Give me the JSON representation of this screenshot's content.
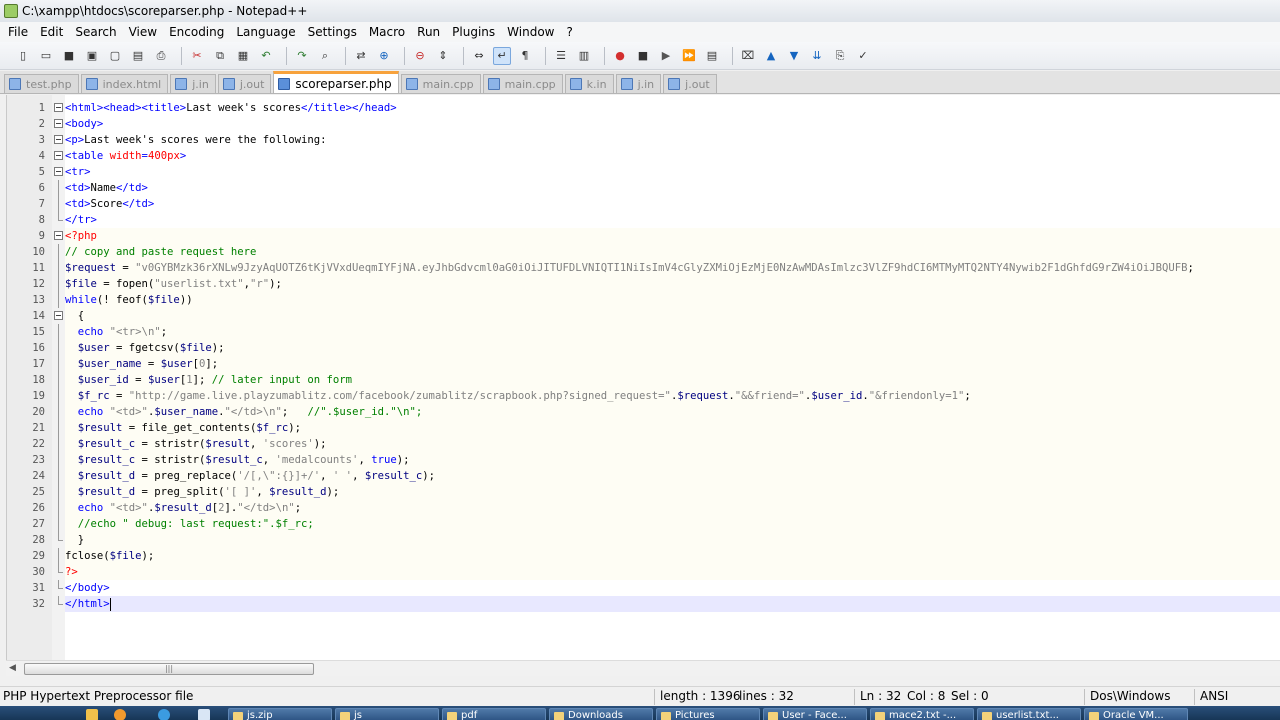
{
  "window": {
    "title": "C:\\xampp\\htdocs\\scoreparser.php - Notepad++"
  },
  "menu": [
    "File",
    "Edit",
    "Search",
    "View",
    "Encoding",
    "Language",
    "Settings",
    "Macro",
    "Run",
    "Plugins",
    "Window",
    "?"
  ],
  "toolbar_icons": [
    "new-file",
    "open-file",
    "save",
    "save-all",
    "close",
    "close-all",
    "print",
    "cut",
    "copy",
    "paste",
    "undo",
    "redo",
    "find",
    "replace",
    "zoom-in",
    "zoom-out",
    "sync-vertical",
    "sync-horizontal",
    "word-wrap",
    "show-all-characters",
    "indent-guide",
    "user-defined-language",
    "record-macro",
    "stop-recording",
    "playback-macro",
    "run-macro-multiple",
    "save-macro",
    "trim",
    "move-up",
    "move-down",
    "sort",
    "clipboard",
    "spell-check"
  ],
  "tabs": [
    {
      "label": "test.php",
      "active": false
    },
    {
      "label": "index.html",
      "active": false
    },
    {
      "label": "j.in",
      "active": false
    },
    {
      "label": "j.out",
      "active": false
    },
    {
      "label": "scoreparser.php",
      "active": true
    },
    {
      "label": "main.cpp",
      "active": false
    },
    {
      "label": "main.cpp",
      "active": false
    },
    {
      "label": "k.in",
      "active": false
    },
    {
      "label": "j.in",
      "active": false
    },
    {
      "label": "j.out",
      "active": false
    }
  ],
  "editor": {
    "current_line": 32,
    "lines": [
      {
        "n": "1",
        "fold": "box",
        "php": false,
        "tokens": [
          [
            "t",
            "<html><head><title>"
          ],
          [
            "n",
            "Last week's scores"
          ],
          [
            "t",
            "</title></head>"
          ]
        ]
      },
      {
        "n": "2",
        "fold": "box",
        "php": false,
        "tokens": [
          [
            "t",
            "<body>"
          ]
        ]
      },
      {
        "n": "3",
        "fold": "box",
        "php": false,
        "tokens": [
          [
            "t",
            "<p>"
          ],
          [
            "n",
            "Last week's scores were the following:"
          ]
        ]
      },
      {
        "n": "4",
        "fold": "box",
        "php": false,
        "tokens": [
          [
            "t",
            "<table "
          ],
          [
            "a",
            "width"
          ],
          [
            "t",
            "="
          ],
          [
            "a",
            "400px"
          ],
          [
            "t",
            ">"
          ]
        ]
      },
      {
        "n": "5",
        "fold": "box",
        "php": false,
        "tokens": [
          [
            "t",
            "<tr>"
          ]
        ]
      },
      {
        "n": "6",
        "fold": "line",
        "php": false,
        "tokens": [
          [
            "t",
            "<td>"
          ],
          [
            "n",
            "Name"
          ],
          [
            "t",
            "</td>"
          ]
        ]
      },
      {
        "n": "7",
        "fold": "line",
        "php": false,
        "tokens": [
          [
            "t",
            "<td>"
          ],
          [
            "n",
            "Score"
          ],
          [
            "t",
            "</td>"
          ]
        ]
      },
      {
        "n": "8",
        "fold": "end",
        "php": false,
        "tokens": [
          [
            "t",
            "</tr>"
          ]
        ]
      },
      {
        "n": "9",
        "fold": "box",
        "php": true,
        "tokens": [
          [
            "p",
            "<?php"
          ]
        ]
      },
      {
        "n": "10",
        "fold": "line",
        "php": true,
        "tokens": [
          [
            "c",
            "// copy and paste request here"
          ]
        ]
      },
      {
        "n": "11",
        "fold": "line",
        "php": true,
        "tokens": [
          [
            "v",
            "$request"
          ],
          [
            "n",
            " = "
          ],
          [
            "s",
            "\"v0GYBMzk36rXNLw9JzyAqUOTZ6tKjVVxdUeqmIYFjNA.eyJhbGdvcml0aG0iOiJITUFDLVNIQTI1NiIsImV4cGlyZXMiOjEzMjE0NzAwMDAsImlzc3VlZF9hdCI6MTMyMTQ2NTY4Nywib2F1dGhfdG9rZW4iOiJBQUFB"
          ],
          [
            "n",
            ";"
          ]
        ]
      },
      {
        "n": "12",
        "fold": "line",
        "php": true,
        "tokens": [
          [
            "v",
            "$file"
          ],
          [
            "n",
            " = fopen("
          ],
          [
            "s",
            "\"userlist.txt\""
          ],
          [
            "n",
            ","
          ],
          [
            "s",
            "\"r\""
          ],
          [
            "n",
            ");"
          ]
        ]
      },
      {
        "n": "13",
        "fold": "line",
        "php": true,
        "tokens": [
          [
            "k",
            "while"
          ],
          [
            "n",
            "(! feof("
          ],
          [
            "v",
            "$file"
          ],
          [
            "n",
            "))"
          ]
        ]
      },
      {
        "n": "14",
        "fold": "box",
        "php": true,
        "tokens": [
          [
            "n",
            "  {"
          ]
        ]
      },
      {
        "n": "15",
        "fold": "line",
        "php": true,
        "tokens": [
          [
            "n",
            "  "
          ],
          [
            "k",
            "echo"
          ],
          [
            "n",
            " "
          ],
          [
            "s",
            "\"<tr>\\n\""
          ],
          [
            "n",
            ";"
          ]
        ]
      },
      {
        "n": "16",
        "fold": "line",
        "php": true,
        "tokens": [
          [
            "n",
            "  "
          ],
          [
            "v",
            "$user"
          ],
          [
            "n",
            " = fgetcsv("
          ],
          [
            "v",
            "$file"
          ],
          [
            "n",
            ");"
          ]
        ]
      },
      {
        "n": "17",
        "fold": "line",
        "php": true,
        "tokens": [
          [
            "n",
            "  "
          ],
          [
            "v",
            "$user_name"
          ],
          [
            "n",
            " = "
          ],
          [
            "v",
            "$user"
          ],
          [
            "n",
            "["
          ],
          [
            "s",
            "0"
          ],
          [
            "n",
            "];"
          ]
        ]
      },
      {
        "n": "18",
        "fold": "line",
        "php": true,
        "tokens": [
          [
            "n",
            "  "
          ],
          [
            "v",
            "$user_id"
          ],
          [
            "n",
            " = "
          ],
          [
            "v",
            "$user"
          ],
          [
            "n",
            "["
          ],
          [
            "s",
            "1"
          ],
          [
            "n",
            "]; "
          ],
          [
            "c",
            "// later input on form"
          ]
        ]
      },
      {
        "n": "19",
        "fold": "line",
        "php": true,
        "tokens": [
          [
            "n",
            "  "
          ],
          [
            "v",
            "$f_rc"
          ],
          [
            "n",
            " = "
          ],
          [
            "s",
            "\"http://game.live.playzumablitz.com/facebook/zumablitz/scrapbook.php?signed_request=\""
          ],
          [
            "n",
            "."
          ],
          [
            "v",
            "$request"
          ],
          [
            "n",
            "."
          ],
          [
            "s",
            "\"&&friend=\""
          ],
          [
            "n",
            "."
          ],
          [
            "v",
            "$user_id"
          ],
          [
            "n",
            "."
          ],
          [
            "s",
            "\"&friendonly=1\""
          ],
          [
            "n",
            ";"
          ]
        ]
      },
      {
        "n": "20",
        "fold": "line",
        "php": true,
        "tokens": [
          [
            "n",
            "  "
          ],
          [
            "k",
            "echo"
          ],
          [
            "n",
            " "
          ],
          [
            "s",
            "\"<td>\""
          ],
          [
            "n",
            "."
          ],
          [
            "v",
            "$user_name"
          ],
          [
            "n",
            "."
          ],
          [
            "s",
            "\"</td>\\n\""
          ],
          [
            "n",
            ";   "
          ],
          [
            "c",
            "//\".$user_id.\"\\n\";"
          ]
        ]
      },
      {
        "n": "21",
        "fold": "line",
        "php": true,
        "tokens": [
          [
            "n",
            "  "
          ],
          [
            "v",
            "$result"
          ],
          [
            "n",
            " = file_get_contents("
          ],
          [
            "v",
            "$f_rc"
          ],
          [
            "n",
            ");"
          ]
        ]
      },
      {
        "n": "22",
        "fold": "line",
        "php": true,
        "tokens": [
          [
            "n",
            "  "
          ],
          [
            "v",
            "$result_c"
          ],
          [
            "n",
            " = stristr("
          ],
          [
            "v",
            "$result"
          ],
          [
            "n",
            ", "
          ],
          [
            "s",
            "'scores'"
          ],
          [
            "n",
            ");"
          ]
        ]
      },
      {
        "n": "23",
        "fold": "line",
        "php": true,
        "tokens": [
          [
            "n",
            "  "
          ],
          [
            "v",
            "$result_c"
          ],
          [
            "n",
            " = stristr("
          ],
          [
            "v",
            "$result_c"
          ],
          [
            "n",
            ", "
          ],
          [
            "s",
            "'medalcounts'"
          ],
          [
            "n",
            ", "
          ],
          [
            "k",
            "true"
          ],
          [
            "n",
            ");"
          ]
        ]
      },
      {
        "n": "24",
        "fold": "line",
        "php": true,
        "tokens": [
          [
            "n",
            "  "
          ],
          [
            "v",
            "$result_d"
          ],
          [
            "n",
            " = preg_replace("
          ],
          [
            "s",
            "'/[,\\\":{}]+/'"
          ],
          [
            "n",
            ", "
          ],
          [
            "s",
            "' '"
          ],
          [
            "n",
            ", "
          ],
          [
            "v",
            "$result_c"
          ],
          [
            "n",
            ");"
          ]
        ]
      },
      {
        "n": "25",
        "fold": "line",
        "php": true,
        "tokens": [
          [
            "n",
            "  "
          ],
          [
            "v",
            "$result_d"
          ],
          [
            "n",
            " = preg_split("
          ],
          [
            "s",
            "'[ ]'"
          ],
          [
            "n",
            ", "
          ],
          [
            "v",
            "$result_d"
          ],
          [
            "n",
            ");"
          ]
        ]
      },
      {
        "n": "26",
        "fold": "line",
        "php": true,
        "tokens": [
          [
            "n",
            "  "
          ],
          [
            "k",
            "echo"
          ],
          [
            "n",
            " "
          ],
          [
            "s",
            "\"<td>\""
          ],
          [
            "n",
            "."
          ],
          [
            "v",
            "$result_d"
          ],
          [
            "n",
            "["
          ],
          [
            "s",
            "2"
          ],
          [
            "n",
            "]."
          ],
          [
            "s",
            "\"</td>\\n\""
          ],
          [
            "n",
            ";"
          ]
        ]
      },
      {
        "n": "27",
        "fold": "line",
        "php": true,
        "tokens": [
          [
            "n",
            "  "
          ],
          [
            "c",
            "//echo \" debug: last request:\".$f_rc;"
          ]
        ]
      },
      {
        "n": "28",
        "fold": "end",
        "php": true,
        "tokens": [
          [
            "n",
            "  }"
          ]
        ]
      },
      {
        "n": "29",
        "fold": "line",
        "php": true,
        "tokens": [
          [
            "n",
            "fclose("
          ],
          [
            "v",
            "$file"
          ],
          [
            "n",
            ");"
          ]
        ]
      },
      {
        "n": "30",
        "fold": "end",
        "php": true,
        "tokens": [
          [
            "p",
            "?>"
          ]
        ]
      },
      {
        "n": "31",
        "fold": "end",
        "php": false,
        "tokens": [
          [
            "t",
            "</body>"
          ]
        ]
      },
      {
        "n": "32",
        "fold": "end",
        "php": false,
        "tokens": [
          [
            "t",
            "</html>"
          ]
        ]
      }
    ]
  },
  "status": {
    "file_type": "PHP Hypertext Preprocessor file",
    "length": "length : 1396",
    "lines": "lines : 32",
    "ln": "Ln : 32",
    "col": "Col : 8",
    "sel": "Sel : 0",
    "eol": "Dos\\Windows",
    "encoding": "ANSI"
  },
  "taskbar": [
    "js.zip",
    "js",
    "pdf",
    "Downloads",
    "Pictures",
    "User - Face...",
    "mace2.txt -...",
    "userlist.txt...",
    "Oracle VM..."
  ]
}
